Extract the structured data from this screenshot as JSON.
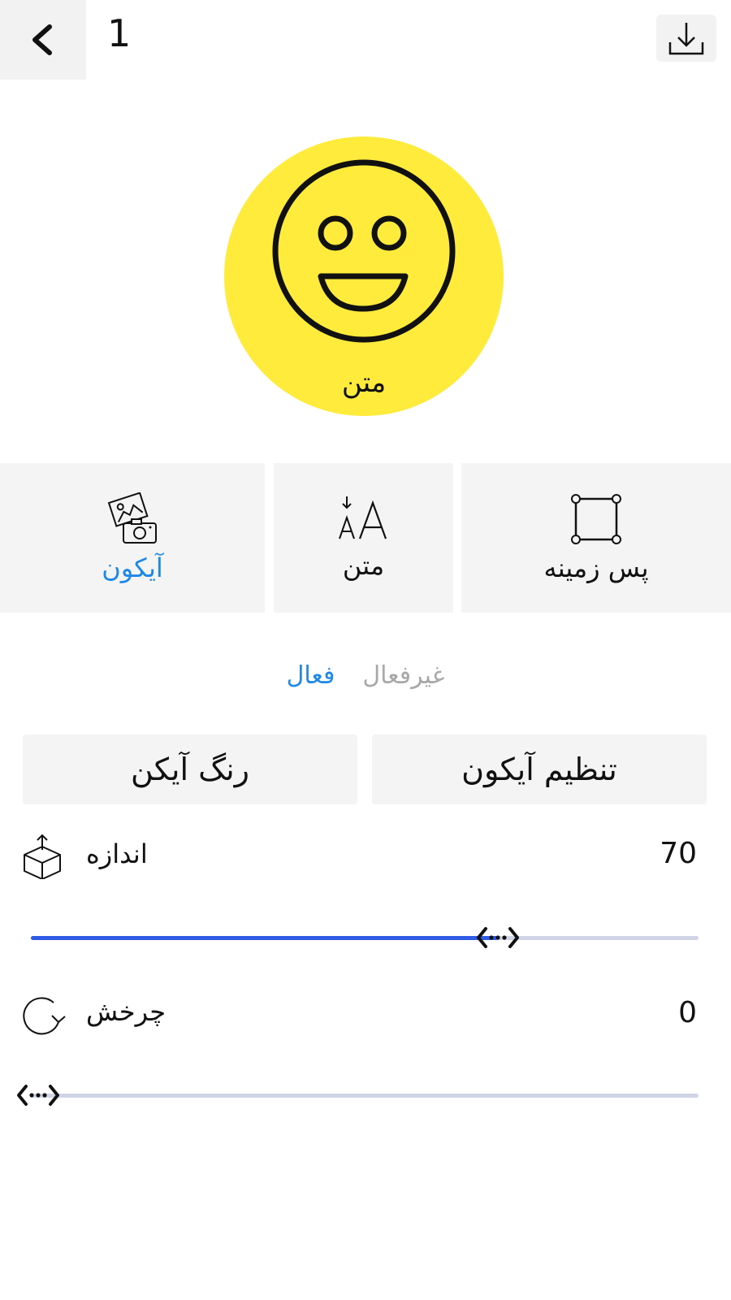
{
  "header": {
    "counter": "1"
  },
  "preview": {
    "text": "متن",
    "background_color": "#ffeb3b"
  },
  "tools": [
    {
      "label": "آیکون",
      "active": true
    },
    {
      "label": "متن",
      "active": false
    },
    {
      "label": "پس زمینه",
      "active": false
    }
  ],
  "toggle": {
    "active_label": "فعال",
    "inactive_label": "غیرفعال",
    "selected": "فعال"
  },
  "buttons": {
    "icon_color": "رنگ آیکن",
    "icon_settings": "تنظیم آیکون"
  },
  "size": {
    "label": "اندازه",
    "value": "70",
    "slider_fraction": 0.7
  },
  "rotation": {
    "label": "چرخش",
    "value": "0",
    "slider_fraction": 0
  },
  "colors": {
    "accent": "#1e88e5",
    "slider_fill": "#2f5be6",
    "slider_track": "#cfd4e6"
  }
}
